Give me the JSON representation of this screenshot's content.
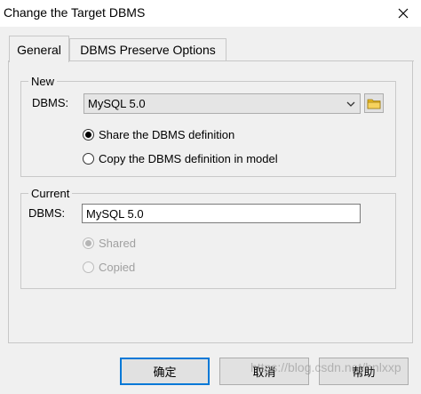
{
  "window": {
    "title": "Change the Target DBMS",
    "close_icon": "close-icon"
  },
  "tabs": [
    {
      "label": "General",
      "active": true
    },
    {
      "label": "DBMS Preserve Options",
      "active": false
    }
  ],
  "new_group": {
    "legend": "New",
    "dbms_label": "DBMS:",
    "dbms_value": "MySQL 5.0",
    "dropdown_icon": "chevron-down-icon",
    "browse_icon": "folder-icon",
    "options": [
      {
        "label": "Share the DBMS definition",
        "selected": true
      },
      {
        "label": "Copy the DBMS definition in model",
        "selected": false
      }
    ]
  },
  "current_group": {
    "legend": "Current",
    "dbms_label": "DBMS:",
    "dbms_value": "MySQL 5.0",
    "options": [
      {
        "label": "Shared",
        "selected": true,
        "enabled": false
      },
      {
        "label": "Copied",
        "selected": false,
        "enabled": false
      }
    ]
  },
  "buttons": {
    "ok": "确定",
    "cancel": "取消",
    "help": "帮助"
  },
  "watermark": "https://blog.csdn.net/hnlxxp",
  "colors": {
    "accent": "#0078d7",
    "dialog_background": "#f0f0f0",
    "folder": "#e8b923"
  }
}
